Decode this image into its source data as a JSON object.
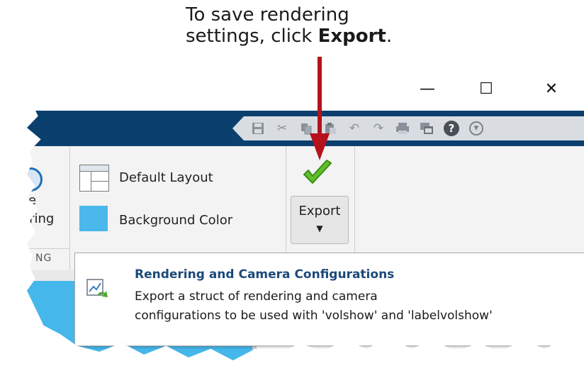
{
  "callout": {
    "line1": "To save rendering",
    "line2_prefix": "settings, click ",
    "line2_bold": "Export",
    "line2_suffix": "."
  },
  "window_controls": {
    "minimize": "—",
    "maximize": "☐",
    "close": "✕"
  },
  "quick_access": {
    "icons": [
      "save-icon",
      "cut-icon",
      "copy-icon",
      "paste-icon",
      "undo-icon",
      "redo-icon",
      "print-icon",
      "switch-windows-icon",
      "help-icon",
      "expand-icon"
    ],
    "help_glyph": "?"
  },
  "ribbon": {
    "left_partial_label_1": "e",
    "left_partial_label_2": "ering",
    "left_section_label": "NG",
    "default_layout_label": "Default Layout",
    "background_color_label": "Background Color",
    "background_color_value": "#4bb8ec",
    "export_label": "Export",
    "export_dropdown_glyph": "▼"
  },
  "tooltip": {
    "title": "Rendering and Camera Configurations",
    "desc_line1": "Export a struct of rendering and camera",
    "desc_line2": "configurations to be used with 'volshow' and 'labelvolshow'"
  },
  "colors": {
    "title_band": "#0b3f6e",
    "arrow": "#b5121b",
    "tooltip_title": "#1c4a7a",
    "panel_blue": "#45b7ea"
  }
}
